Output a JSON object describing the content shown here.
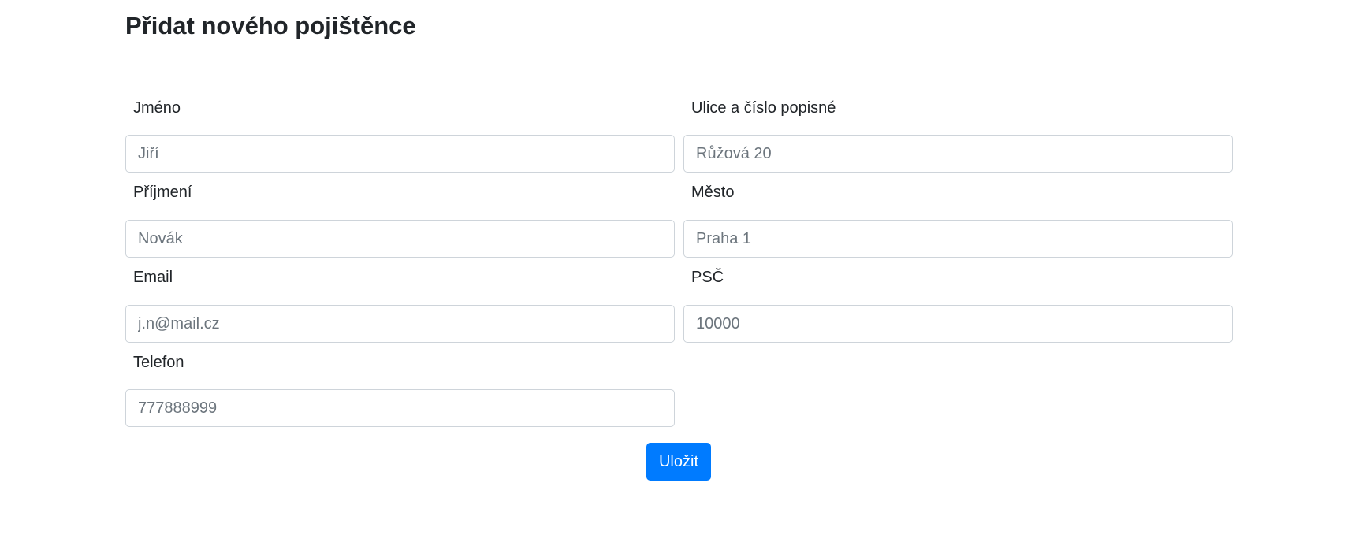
{
  "page": {
    "title": "Přidat nového pojištěnce"
  },
  "form": {
    "first_name": {
      "label": "Jméno",
      "value": "",
      "placeholder": "Jiří"
    },
    "street": {
      "label": "Ulice a číslo popisné",
      "value": "",
      "placeholder": "Růžová 20"
    },
    "last_name": {
      "label": "Příjmení",
      "value": "",
      "placeholder": "Novák"
    },
    "city": {
      "label": "Město",
      "value": "",
      "placeholder": "Praha 1"
    },
    "email": {
      "label": "Email",
      "value": "",
      "placeholder": "j.n@mail.cz"
    },
    "zip": {
      "label": "PSČ",
      "value": "",
      "placeholder": "10000"
    },
    "phone": {
      "label": "Telefon",
      "value": "",
      "placeholder": "777888999"
    },
    "save_label": "Uložit"
  },
  "colors": {
    "primary": "#007bff",
    "text": "#212529",
    "placeholder": "#6c757d",
    "input_border": "#ced4da",
    "background": "#ffffff"
  }
}
